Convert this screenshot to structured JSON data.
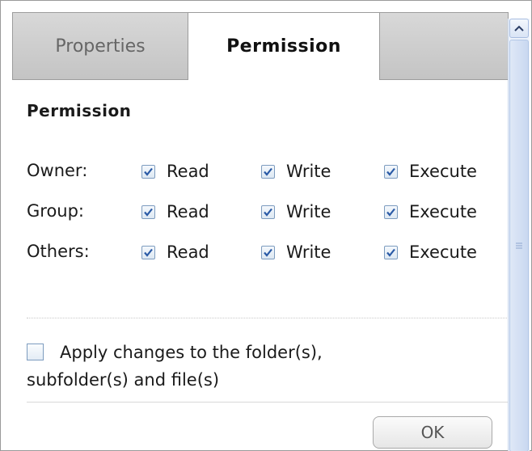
{
  "tabs": {
    "properties": "Properties",
    "permission": "Permission"
  },
  "section_title": "Permission",
  "rows": [
    {
      "label": "Owner:",
      "read": "Read",
      "write": "Write",
      "execute": "Execute",
      "read_checked": true,
      "write_checked": true,
      "execute_checked": true
    },
    {
      "label": "Group:",
      "read": "Read",
      "write": "Write",
      "execute": "Execute",
      "read_checked": true,
      "write_checked": true,
      "execute_checked": true
    },
    {
      "label": "Others:",
      "read": "Read",
      "write": "Write",
      "execute": "Execute",
      "read_checked": true,
      "write_checked": true,
      "execute_checked": true
    }
  ],
  "apply": {
    "line1": "Apply changes to the folder(s),",
    "line2": "subfolder(s) and file(s)",
    "checked": false
  },
  "buttons": {
    "ok": "OK"
  },
  "colors": {
    "checkmark": "#2a5aa6",
    "scroll_accent": "#c9d8f0"
  },
  "icons": {
    "scroll_up": "chevron-up-icon",
    "scroll_grip": "grip-icon",
    "checkbox": "checkmark-icon"
  }
}
